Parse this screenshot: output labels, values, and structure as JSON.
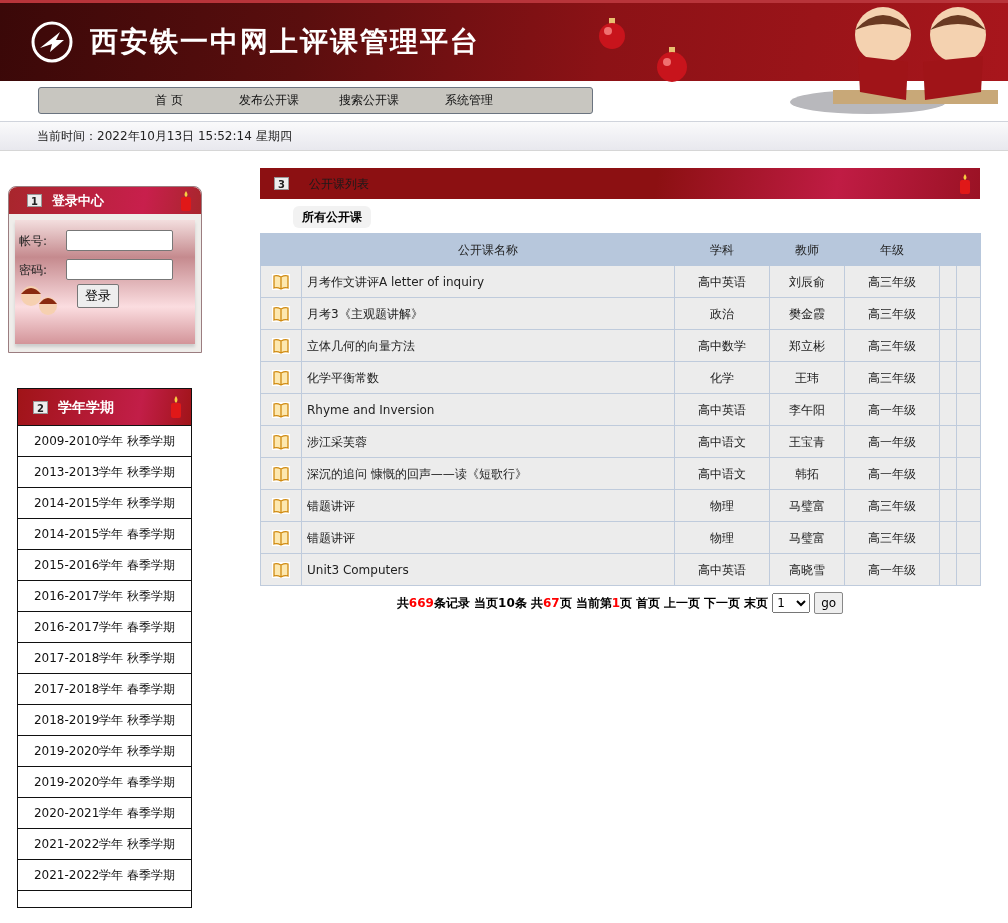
{
  "header": {
    "title": "西安铁一中网上评课管理平台"
  },
  "nav": [
    {
      "label": "首 页"
    },
    {
      "label": "发布公开课"
    },
    {
      "label": "搜索公开课"
    },
    {
      "label": "系统管理"
    }
  ],
  "time_bar": {
    "text": "当前时间：2022年10月13日 15:52:14 星期四"
  },
  "login": {
    "number": "1",
    "title": "登录中心",
    "account_label": "帐号:",
    "password_label": "密码:",
    "button": "登录"
  },
  "terms": {
    "number": "2",
    "title": "学年学期",
    "items": [
      {
        "label": "2009-2010学年 秋季学期"
      },
      {
        "label": "2013-2013学年 秋季学期"
      },
      {
        "label": "2014-2015学年 秋季学期"
      },
      {
        "label": "2014-2015学年 春季学期"
      },
      {
        "label": "2015-2016学年 春季学期"
      },
      {
        "label": "2016-2017学年 秋季学期"
      },
      {
        "label": "2016-2017学年 春季学期"
      },
      {
        "label": "2017-2018学年 秋季学期"
      },
      {
        "label": "2017-2018学年 春季学期"
      },
      {
        "label": "2018-2019学年 秋季学期"
      },
      {
        "label": "2019-2020学年 秋季学期"
      },
      {
        "label": "2019-2020学年 春季学期"
      },
      {
        "label": "2020-2021学年 春季学期"
      },
      {
        "label": "2021-2022学年 秋季学期"
      },
      {
        "label": "2021-2022学年 春季学期"
      }
    ]
  },
  "list": {
    "number": "3",
    "title": "公开课列表",
    "tab": "所有公开课",
    "columns": [
      "公开课名称",
      "学科",
      "教师",
      "年级"
    ],
    "rows": [
      [
        "月考作文讲评A letter of inquiry",
        "高中英语",
        "刘辰俞",
        "高三年级"
      ],
      [
        "月考3《主观题讲解》",
        "政治",
        "樊金霞",
        "高三年级"
      ],
      [
        "立体几何的向量方法",
        "高中数学",
        "郑立彬",
        "高三年级"
      ],
      [
        "化学平衡常数",
        "化学",
        "王玮",
        "高三年级"
      ],
      [
        "Rhyme and Inversion",
        "高中英语",
        "李午阳",
        "高一年级"
      ],
      [
        "涉江采芙蓉",
        "高中语文",
        "王宝青",
        "高一年级"
      ],
      [
        "深沉的追问 慷慨的回声——读《短歌行》",
        "高中语文",
        "韩拓",
        "高一年级"
      ],
      [
        "错题讲评",
        "物理",
        "马璧富",
        "高三年级"
      ],
      [
        "错题讲评",
        "物理",
        "马璧富",
        "高三年级"
      ],
      [
        "Unit3 Computers",
        "高中英语",
        "高晓雪",
        "高一年级"
      ]
    ]
  },
  "pager": {
    "summary": [
      {
        "text": "共",
        "kind": "label"
      },
      {
        "text": "669",
        "kind": "number"
      },
      {
        "text": "条记录 当页10条 共",
        "kind": "label"
      },
      {
        "text": "67",
        "kind": "number"
      },
      {
        "text": "页 当前第",
        "kind": "label"
      },
      {
        "text": "1",
        "kind": "number"
      },
      {
        "text": "页",
        "kind": "label"
      }
    ],
    "links": [
      "首页",
      "上一页",
      "下一页",
      "末页"
    ],
    "page_select": "1",
    "go": "go"
  }
}
